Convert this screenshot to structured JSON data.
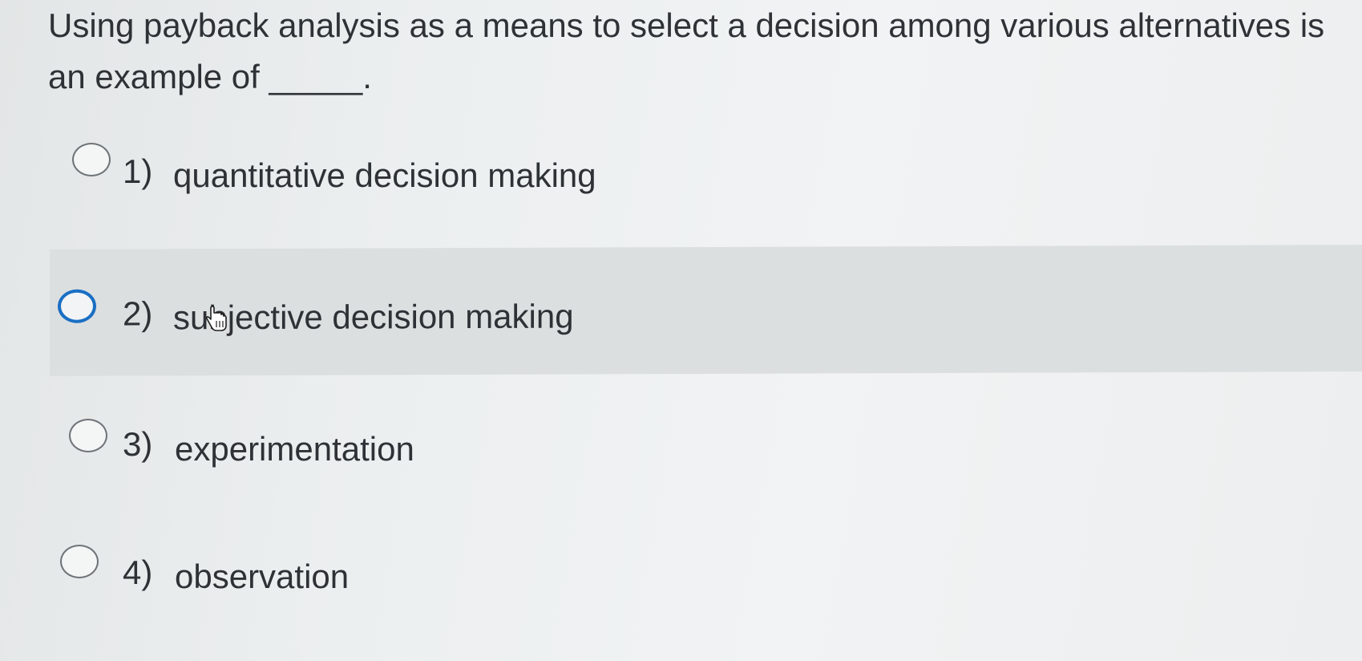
{
  "question": {
    "line1": "Using payback analysis as a means to select a decision among various alternatives is",
    "line2": "an example of _____."
  },
  "options": [
    {
      "number": "1)",
      "label": "quantitative decision making",
      "hovered": false
    },
    {
      "number": "2)",
      "label": "subjective decision making",
      "hovered": true
    },
    {
      "number": "3)",
      "label": "experimentation",
      "hovered": false
    },
    {
      "number": "4)",
      "label": "observation",
      "hovered": false
    }
  ],
  "colors": {
    "focus_ring": "#1a6fc4",
    "hover_background": "#dcdfe0",
    "text": "#2e3236"
  },
  "icons": {
    "cursor": "hand-pointer-icon"
  }
}
